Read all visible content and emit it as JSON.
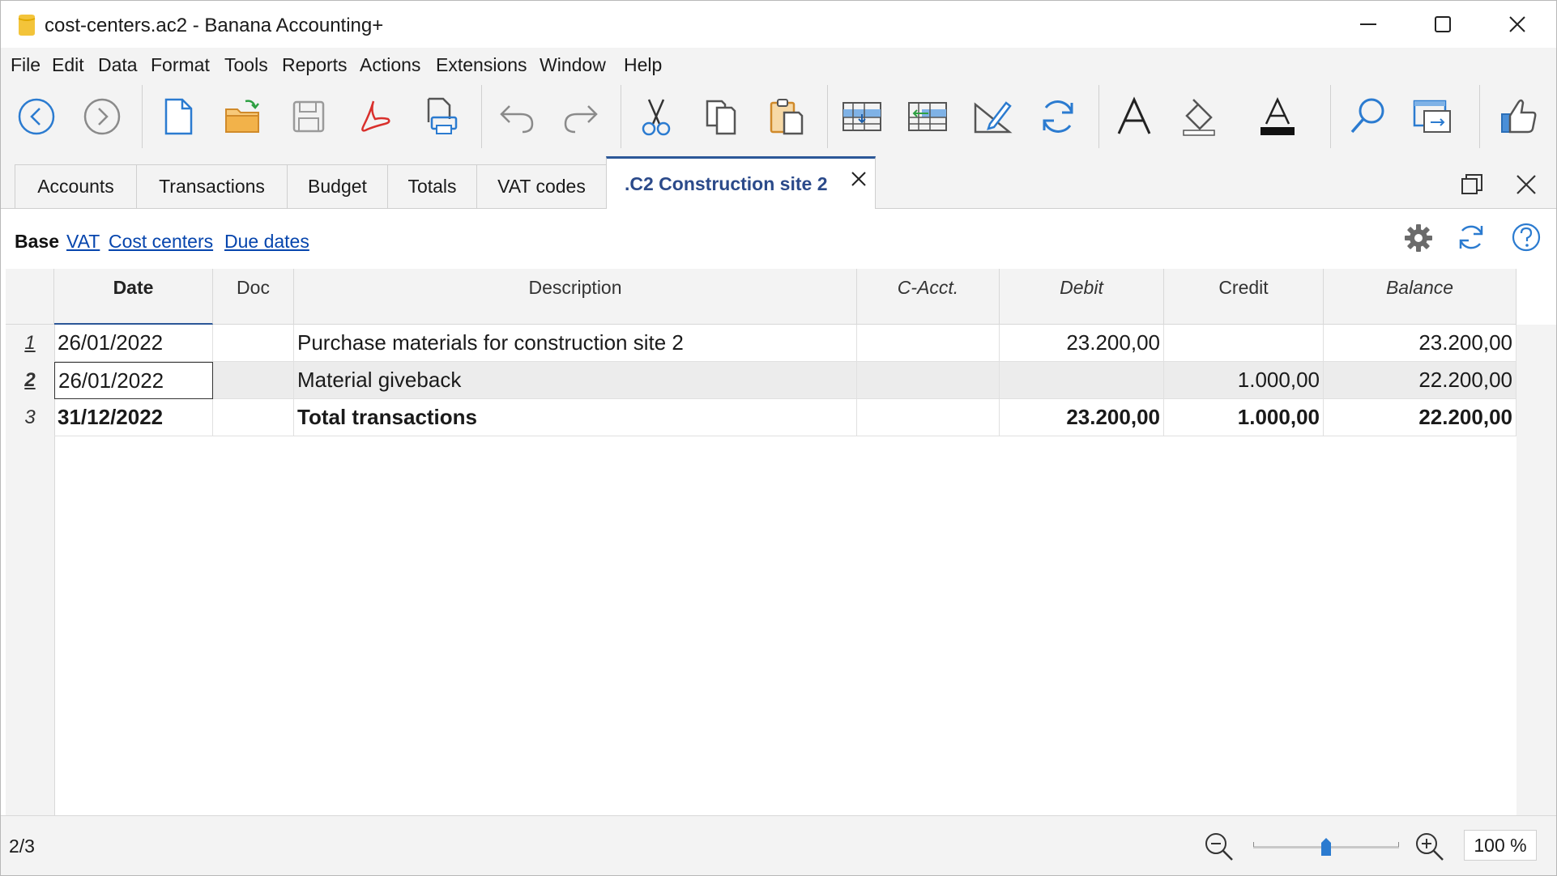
{
  "window": {
    "title": "cost-centers.ac2 - Banana Accounting+",
    "minimize_glyph": "─",
    "maximize_glyph": "☐",
    "close_glyph": "✕"
  },
  "menu": [
    "File",
    "Edit",
    "Data",
    "Format",
    "Tools",
    "Reports",
    "Actions",
    "Extensions",
    "Window",
    "Help"
  ],
  "toolbar": {
    "icons": [
      "back-icon",
      "forward-icon",
      "new-file-icon",
      "open-folder-icon",
      "save-icon",
      "pdf-icon",
      "print-preview-icon",
      "undo-icon",
      "redo-icon",
      "cut-icon",
      "copy-icon",
      "paste-icon",
      "add-rows-icon",
      "insert-rows-icon",
      "edit-icon",
      "recheck-icon",
      "font-icon",
      "fill-color-icon",
      "text-color-icon",
      "find-icon",
      "window-icon",
      "feedback-icon"
    ]
  },
  "tabs": [
    {
      "label": "Accounts"
    },
    {
      "label": "Transactions"
    },
    {
      "label": "Budget"
    },
    {
      "label": "Totals"
    },
    {
      "label": "VAT codes"
    },
    {
      "label": ".C2 Construction site 2",
      "active": true
    }
  ],
  "views": [
    "Base",
    "VAT",
    "Cost centers",
    "Due dates"
  ],
  "columns": [
    "Date",
    "Doc",
    "Description",
    "C-Acct.",
    "Debit",
    "Credit",
    "Balance"
  ],
  "rows": [
    {
      "num": "1",
      "date": "26/01/2022",
      "doc": "",
      "description": "Purchase materials for construction site 2",
      "cacct": "",
      "debit": "23.200,00",
      "credit": "",
      "balance": "23.200,00"
    },
    {
      "num": "2",
      "date": "26/01/2022",
      "doc": "",
      "description": "Material giveback",
      "cacct": "",
      "debit": "",
      "credit": "1.000,00",
      "balance": "22.200,00"
    },
    {
      "num": "3",
      "date": "31/12/2022",
      "doc": "",
      "description": "Total transactions",
      "cacct": "",
      "debit": "23.200,00",
      "credit": "1.000,00",
      "balance": "22.200,00"
    }
  ],
  "status": {
    "row_position": "2/3",
    "zoom": "100 %",
    "zoom_level": 0.5
  },
  "colors": {
    "accent": "#2b5797",
    "link": "#0645ad",
    "selected_row_bg": "#ececec"
  }
}
